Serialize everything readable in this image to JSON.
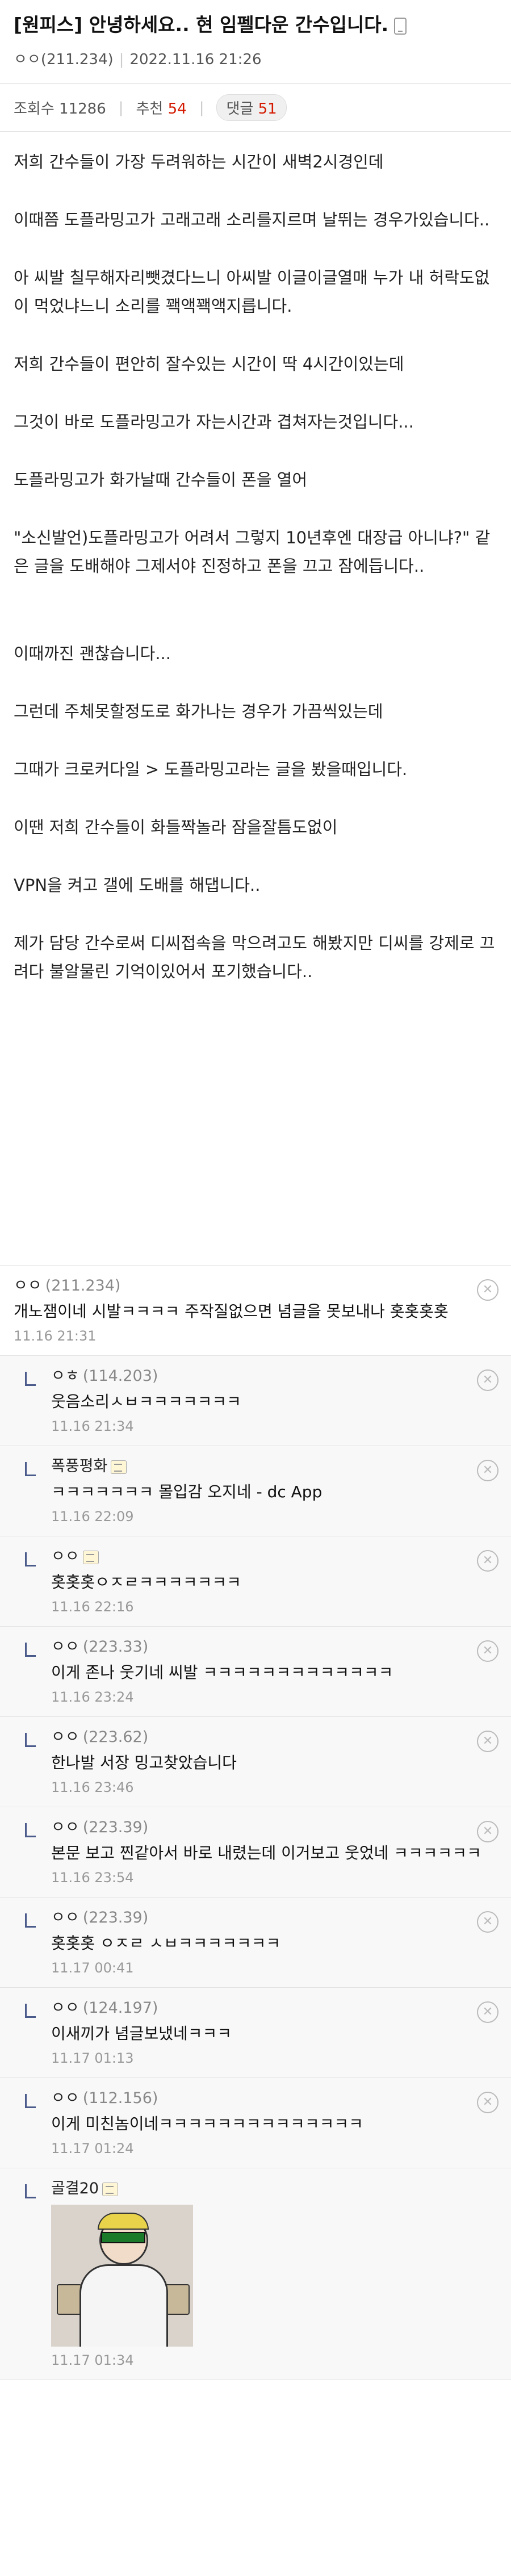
{
  "post": {
    "title": "[원피스] 안녕하세요.. 현 임펠다운 간수입니다.",
    "author": "ㅇㅇ(211.234)",
    "date": "2022.11.16 21:26",
    "views_label": "조회수 11286",
    "recommend_label": "추천",
    "recommend_count": "54",
    "comment_label": "댓글",
    "comment_count": "51"
  },
  "body": [
    "저희 간수들이 가장 두려워하는 시간이 새벽2시경인데",
    "이때쯤 도플라밍고가 고래고래 소리를지르며 날뛰는 경우가있습니다..",
    "아 씨발 칠무해자리뺏겼다느니 아씨발 이글이글열매 누가 내 허락도없이 먹었냐느니 소리를 꽥액꽥액지릅니다.",
    "저희 간수들이 편안히 잘수있는 시간이 딱 4시간이있는데",
    "그것이 바로 도플라밍고가 자는시간과 겹쳐자는것입니다...",
    "도플라밍고가 화가날때 간수들이 폰을 열어",
    "\"소신발언)도플라밍고가 어려서 그렇지 10년후엔 대장급 아니냐?\" 같은 글을 도배해야 그제서야 진정하고 폰을 끄고 잠에듭니다..",
    "이때까진 괜찮습니다...",
    "그런데 주체못할정도로 화가나는 경우가 가끔씩있는데",
    "그때가 크로커다일 > 도플라밍고라는 글을 봤을때입니다.",
    "이땐 저희 간수들이 화들짝놀라 잠을잘틈도없이",
    "VPN을 켜고 갤에 도배를 해댑니다..",
    "제가 담당 간수로써 디씨접속을 막으려고도 해봤지만 디씨를 강제로 끄려다 불알물린 기억이있어서 포기했습니다.."
  ],
  "comments": [
    {
      "nick": "ㅇㅇ",
      "ip": "(211.234)",
      "text": "개노잼이네 시발ㅋㅋㅋㅋ 주작질없으면 념글을 못보내나 홋홋홋홋",
      "date": "11.16 21:31",
      "reply": false
    },
    {
      "nick": "ㅇㅎ",
      "ip": "(114.203)",
      "text": "웃음소리ㅅㅂㅋㅋㅋㅋㅋㅋㅋ",
      "date": "11.16 21:34",
      "reply": true
    },
    {
      "nick": "폭풍평화",
      "ip": "",
      "text": "ㅋㅋㅋㅋㅋㅋㅋ 몰입감 오지네 - dc App",
      "date": "11.16 22:09",
      "reply": true,
      "gallog": true
    },
    {
      "nick": "ㅇㅇ",
      "ip": "",
      "text": "홋홋홋ㅇㅈㄹㅋㅋㅋㅋㅋㅋㅋ",
      "date": "11.16 22:16",
      "reply": true,
      "gallog": true
    },
    {
      "nick": "ㅇㅇ",
      "ip": "(223.33)",
      "text": "이게 존나 웃기네 씨발 ㅋㅋㅋㅋㅋㅋㅋㅋㅋㅋㅋㅋㅋ",
      "date": "11.16 23:24",
      "reply": true
    },
    {
      "nick": "ㅇㅇ",
      "ip": "(223.62)",
      "text": "한나발 서장 밍고찾았습니다",
      "date": "11.16 23:46",
      "reply": true
    },
    {
      "nick": "ㅇㅇ",
      "ip": "(223.39)",
      "text": "본문 보고 찐같아서 바로 내렸는데 이거보고 웃었네 ㅋㅋㅋㅋㅋㅋ",
      "date": "11.16 23:54",
      "reply": true
    },
    {
      "nick": "ㅇㅇ",
      "ip": "(223.39)",
      "text": "홋홋홋 ㅇㅈㄹ ㅅㅂㅋㅋㅋㅋㅋㅋㅋ",
      "date": "11.17 00:41",
      "reply": true
    },
    {
      "nick": "ㅇㅇ",
      "ip": "(124.197)",
      "text": "이새끼가 념글보냈네ㅋㅋㅋ",
      "date": "11.17 01:13",
      "reply": true
    },
    {
      "nick": "ㅇㅇ",
      "ip": "(112.156)",
      "text": "이게 미친놈이네ㅋㅋㅋㅋㅋㅋㅋㅋㅋㅋㅋㅋㅋㅋ",
      "date": "11.17 01:24",
      "reply": true
    },
    {
      "nick": "골결20",
      "ip": "",
      "text": "",
      "date": "11.17 01:34",
      "reply": true,
      "gallog": true,
      "dccon": true
    }
  ],
  "icons": {
    "delete": "close-circle-icon",
    "mobile": "mobile-phone-icon",
    "gallog": "gallog-icon"
  }
}
